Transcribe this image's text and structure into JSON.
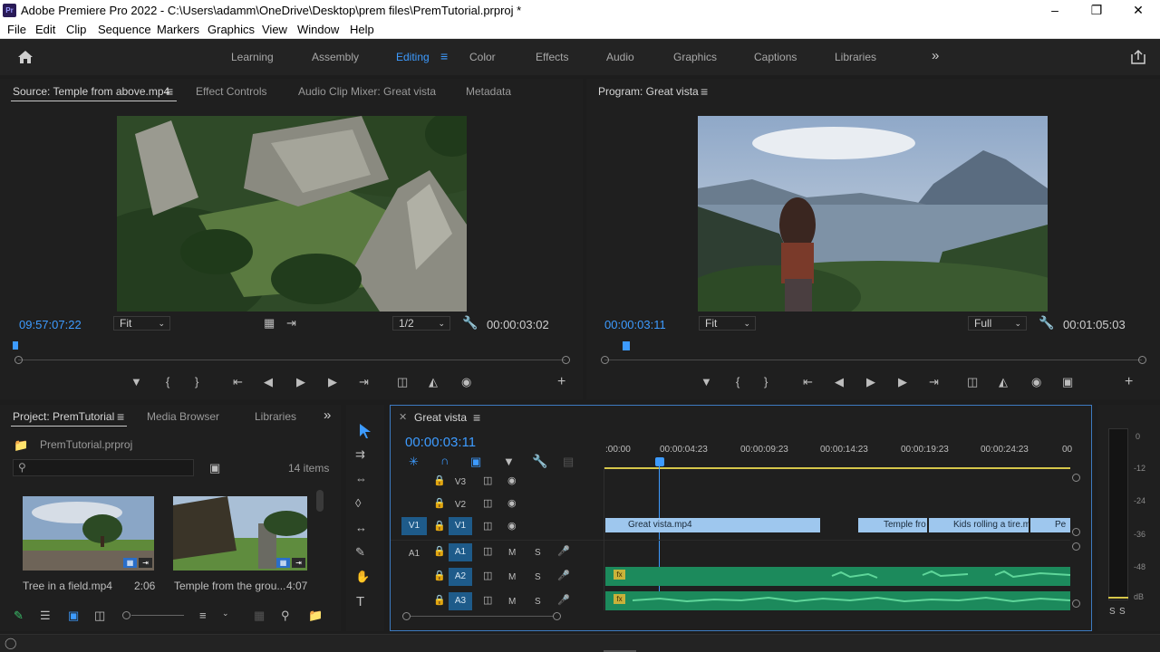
{
  "app": {
    "logo_text": "Pr",
    "title": "Adobe Premiere Pro 2022 - C:\\Users\\adamm\\OneDrive\\Desktop\\prem files\\PremTutorial.prproj *"
  },
  "menu": [
    "File",
    "Edit",
    "Clip",
    "Sequence",
    "Markers",
    "Graphics",
    "View",
    "Window",
    "Help"
  ],
  "workspaces": {
    "items": [
      "Learning",
      "Assembly",
      "Editing",
      "Color",
      "Effects",
      "Audio",
      "Graphics",
      "Captions",
      "Libraries"
    ],
    "active": "Editing"
  },
  "source_panel": {
    "tabs": [
      "Source: Temple from above.mp4",
      "Effect Controls",
      "Audio Clip Mixer: Great vista",
      "Metadata"
    ],
    "timecode_current": "09:57:07:22",
    "fit": "Fit",
    "resolution": "1/2",
    "timecode_duration": "00:00:03:02"
  },
  "program_panel": {
    "tab": "Program: Great vista",
    "timecode_current": "00:00:03:11",
    "fit": "Fit",
    "resolution": "Full",
    "timecode_duration": "00:01:05:03"
  },
  "project_panel": {
    "tabs": [
      "Project: PremTutorial",
      "Media Browser",
      "Libraries"
    ],
    "file": "PremTutorial.prproj",
    "item_count": "14 items",
    "items": [
      {
        "name": "Tree in a field.mp4",
        "duration": "2:06"
      },
      {
        "name": "Temple from the grou...",
        "duration": "4:07"
      }
    ]
  },
  "timeline": {
    "sequence_tab": "Great vista",
    "timecode": "00:00:03:11",
    "ruler": [
      ":00:00",
      "00:00:04:23",
      "00:00:09:23",
      "00:00:14:23",
      "00:00:19:23",
      "00:00:24:23",
      "00"
    ],
    "video_tracks": [
      "V3",
      "V2",
      "V1"
    ],
    "audio_tracks": [
      "A1",
      "A2",
      "A3"
    ],
    "source_v": "V1",
    "source_a": "A1",
    "track_m": "M",
    "track_s": "S",
    "clips": [
      "Great vista.mp4",
      "Temple fro",
      "Kids rolling a tire.m",
      "Pe"
    ],
    "fx": "fx"
  },
  "meter": {
    "scale": [
      "0",
      "-12",
      "-24",
      "-36",
      "-48",
      "dB"
    ],
    "solo": [
      "S",
      "S"
    ]
  }
}
